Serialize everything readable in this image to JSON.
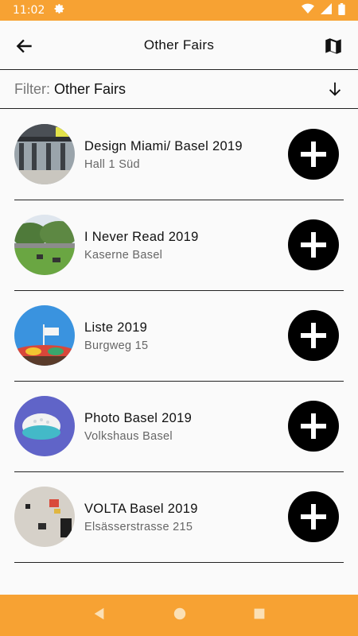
{
  "status_bar": {
    "time": "11:02"
  },
  "app_bar": {
    "title": "Other Fairs"
  },
  "filter": {
    "label": "Filter:",
    "value": "Other Fairs"
  },
  "fairs": [
    {
      "name": "Design Miami/ Basel 2019",
      "location": "Hall 1 Süd"
    },
    {
      "name": "I Never Read 2019",
      "location": "Kaserne Basel"
    },
    {
      "name": "Liste 2019",
      "location": "Burgweg 15"
    },
    {
      "name": "Photo Basel 2019",
      "location": "Volkshaus Basel"
    },
    {
      "name": "VOLTA Basel 2019",
      "location": "Elsässerstrasse 215"
    }
  ],
  "colors": {
    "accent": "#f7a233",
    "divider": "#222222"
  }
}
